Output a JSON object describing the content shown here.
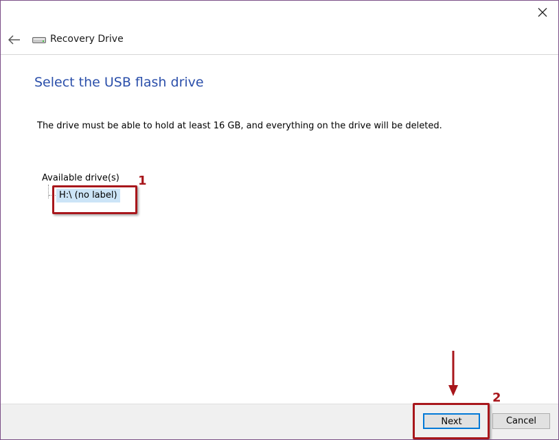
{
  "window": {
    "title": "Recovery Drive"
  },
  "page": {
    "heading": "Select the USB flash drive",
    "description": "The drive must be able to hold at least 16 GB, and everything on the drive will be deleted.",
    "drives_label": "Available drive(s)",
    "drives": [
      {
        "label": "H:\\ (no label)",
        "selected": true
      }
    ]
  },
  "buttons": {
    "next": "Next",
    "cancel": "Cancel"
  },
  "annotations": {
    "step1": "1",
    "step2": "2"
  },
  "colors": {
    "heading": "#2b4faa",
    "callout": "#a8161b",
    "selection": "#cce4f7",
    "focus": "#0078d7"
  },
  "icons": {
    "close": "close-icon",
    "back": "back-arrow-icon",
    "app": "drive-icon"
  }
}
